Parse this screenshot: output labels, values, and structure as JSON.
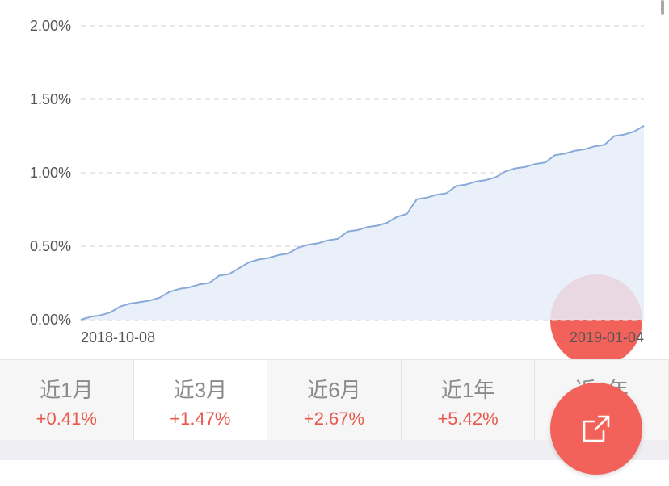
{
  "chart_data": {
    "type": "area",
    "x_tick_labels": [
      "2018-10-08",
      "2019-01-04"
    ],
    "y_tick_labels": [
      "0.00%",
      "0.50%",
      "1.00%",
      "1.50%",
      "2.00%"
    ],
    "y_ticks": [
      0,
      0.5,
      1.0,
      1.5,
      2.0
    ],
    "ylim": [
      0,
      2.0
    ],
    "grid": true,
    "line_color": "#8aaad8",
    "fill_color": "#e6edf9",
    "values": [
      0.0,
      0.02,
      0.03,
      0.05,
      0.09,
      0.11,
      0.12,
      0.13,
      0.15,
      0.19,
      0.21,
      0.22,
      0.24,
      0.25,
      0.3,
      0.31,
      0.35,
      0.39,
      0.41,
      0.42,
      0.44,
      0.45,
      0.49,
      0.51,
      0.52,
      0.54,
      0.55,
      0.6,
      0.61,
      0.63,
      0.64,
      0.66,
      0.7,
      0.72,
      0.82,
      0.83,
      0.85,
      0.86,
      0.91,
      0.92,
      0.94,
      0.95,
      0.97,
      1.01,
      1.03,
      1.04,
      1.06,
      1.07,
      1.12,
      1.13,
      1.15,
      1.16,
      1.18,
      1.19,
      1.25,
      1.26,
      1.28,
      1.32
    ]
  },
  "tabs": [
    {
      "label": "近1月",
      "value": "+0.41%"
    },
    {
      "label": "近3月",
      "value": "+1.47%"
    },
    {
      "label": "近6月",
      "value": "+2.67%"
    },
    {
      "label": "近1年",
      "value": "+5.42%"
    },
    {
      "label": "近3年",
      "value": ""
    }
  ],
  "colors": {
    "accent": "#f3625a",
    "positive": "#e8594d"
  },
  "icons": {
    "share": "share-icon"
  }
}
